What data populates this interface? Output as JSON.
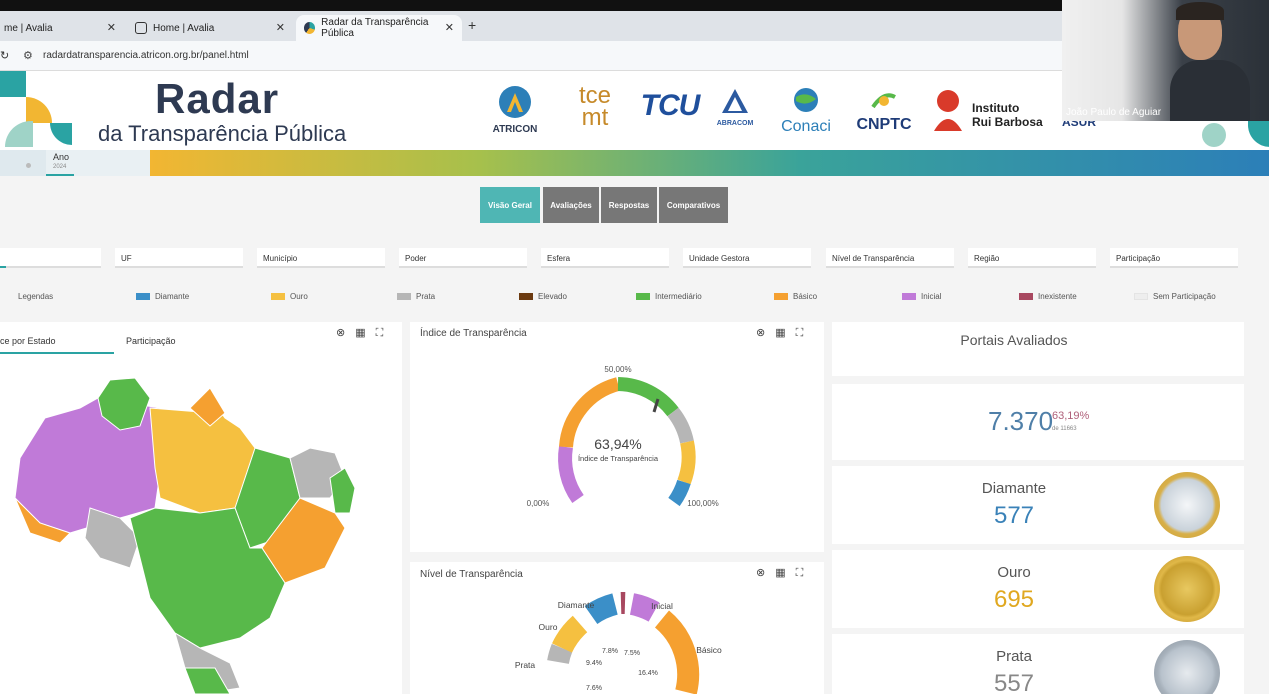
{
  "browser": {
    "tabs": [
      {
        "title": "me | Avalia"
      },
      {
        "title": "Home | Avalia"
      },
      {
        "title": "Radar da Transparência Pública"
      }
    ],
    "new_tab": "+",
    "close_glyph": "✕",
    "url": "radardatransparencia.atricon.org.br/panel.html"
  },
  "header": {
    "title": "Radar",
    "subtitle": "da Transparência Pública",
    "logos": [
      {
        "name": "ATRICON"
      },
      {
        "name_top": "tce",
        "name_bottom": "mt"
      },
      {
        "name": "TCU"
      },
      {
        "name": "ABRACOM"
      },
      {
        "name": "Conaci"
      },
      {
        "name": "CNPTC"
      },
      {
        "name_top": "Instituto",
        "name_bottom": "Rui Barbosa"
      },
      {
        "name": "ASUR"
      }
    ]
  },
  "year_filter": {
    "label": "Ano",
    "value": "2024"
  },
  "nav": {
    "buttons": [
      "Visão Geral",
      "Avaliações",
      "Respostas",
      "Comparativos"
    ],
    "active": "Visão Geral"
  },
  "filters": [
    "",
    "UF",
    "Município",
    "Poder",
    "Esfera",
    "Unidade Gestora",
    "Nível de Transparência",
    "Região",
    "Participação"
  ],
  "legend": {
    "title": "Legendas",
    "items": [
      {
        "label": "Diamante",
        "color": "#3b8fc8"
      },
      {
        "label": "Ouro",
        "color": "#f5c040"
      },
      {
        "label": "Prata",
        "color": "#b6b6b6"
      },
      {
        "label": "Elevado",
        "color": "#6b3a10"
      },
      {
        "label": "Intermediário",
        "color": "#58b94a"
      },
      {
        "label": "Básico",
        "color": "#f5a030"
      },
      {
        "label": "Inicial",
        "color": "#c07ad8"
      },
      {
        "label": "Inexistente",
        "color": "#a84860"
      },
      {
        "label": "Sem Participação",
        "color": "#eeeeee"
      }
    ]
  },
  "map_panel": {
    "tabs": [
      "ce por Estado",
      "Participação"
    ],
    "icons": [
      "close-icon",
      "table-icon",
      "expand-icon"
    ]
  },
  "gauge_panel": {
    "title": "Índice de Transparência",
    "value": 63.94,
    "value_text": "63,94%",
    "caption": "Índice de Transparência",
    "label_min": "0,00%",
    "label_mid": "50,00%",
    "label_max": "100,00%"
  },
  "level_panel": {
    "title": "Nível de Transparência",
    "labels": [
      "Diamante",
      "Inicial",
      "Ouro",
      "Básico",
      "Prata"
    ],
    "percents": [
      "7.8%",
      "7.5%",
      "9.4%",
      "16.4%",
      "7.6%"
    ]
  },
  "portals": {
    "title": "Portais Avaliados",
    "total": "7.370",
    "percent": "63,19%",
    "of_text": "de 11663",
    "cards": [
      {
        "name": "Diamante",
        "count": "577",
        "color": "#3a82b8"
      },
      {
        "name": "Ouro",
        "count": "695",
        "color": "#e0a820"
      },
      {
        "name": "Prata",
        "count": "557",
        "color": "#888888"
      }
    ]
  },
  "webcam": {
    "name": "João Paulo de Aguiar"
  },
  "colors": {
    "teal": "#2aa3a3",
    "navy": "#2e3a52",
    "button_gray": "#777777"
  }
}
